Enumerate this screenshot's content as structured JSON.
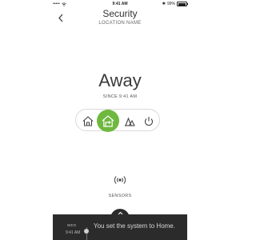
{
  "status_bar": {
    "carrier_dots": "•••••",
    "time": "9:41 AM",
    "bluetooth": "✱",
    "battery": "99%"
  },
  "header": {
    "title": "Security",
    "subtitle": "LOCATION NAME"
  },
  "security": {
    "mode": "Away",
    "since": "SINCE 9:41 AM"
  },
  "mode_selector": {
    "active": "home",
    "active_color": "#6fb83f",
    "options": [
      "away-icon",
      "home-icon",
      "night-icon",
      "off-icon"
    ]
  },
  "sensors": {
    "label": "SENSORS"
  },
  "notification": {
    "day": "WED",
    "time": "9:41 AM",
    "message": "You set the system to Home."
  }
}
